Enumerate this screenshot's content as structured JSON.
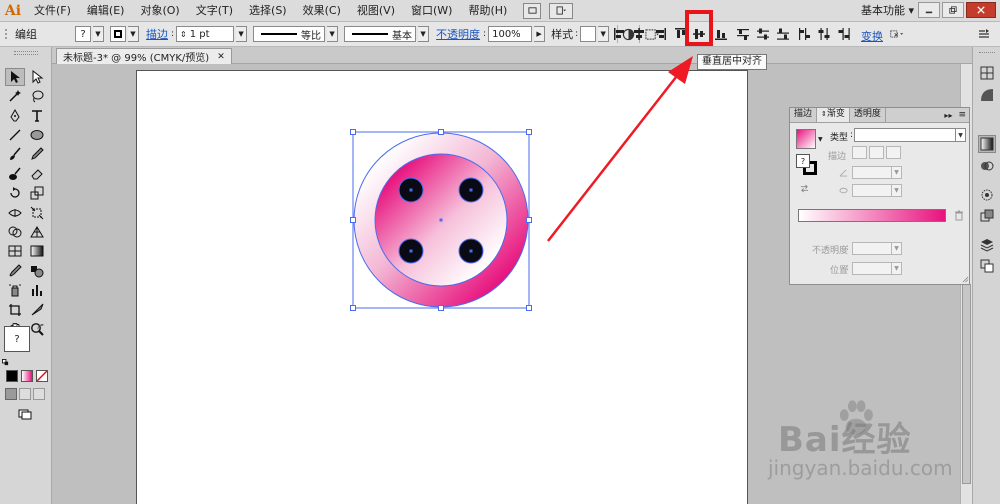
{
  "app": {
    "logo": "Ai",
    "menu": [
      "文件(F)",
      "编辑(E)",
      "对象(O)",
      "文字(T)",
      "选择(S)",
      "效果(C)",
      "视图(V)",
      "窗口(W)",
      "帮助(H)"
    ],
    "workspace": "基本功能 ▾"
  },
  "control_bar": {
    "mode": "编组",
    "fill_value": "?",
    "stroke_link": "描边",
    "stroke_weight": "1 pt",
    "profile_label": "等比",
    "brush_label": "基本",
    "opacity_link": "不透明度",
    "opacity_value": "100%",
    "style_label": "样式",
    "transform_link": "变换"
  },
  "tooltip": "垂直居中对齐",
  "document": {
    "tab": "未标题-3* @ 99% (CMYK/预览)",
    "tab_close": "✕"
  },
  "toolbox": {
    "fill_value": "?"
  },
  "panel": {
    "tabs": [
      "描边",
      "渐变",
      "透明度"
    ],
    "active_tab": "渐变",
    "type_label": "类型",
    "stroke_label": "描边",
    "opacity_label": "不透明度",
    "position_label": "位置"
  },
  "watermark": {
    "text": "Bai经验",
    "url": "jingyan.baidu.com"
  },
  "colors": {
    "gradient_start": "#ffffff",
    "gradient_end": "#e8137e",
    "highlight": "#e8141a",
    "selection": "#4a6cf0"
  }
}
